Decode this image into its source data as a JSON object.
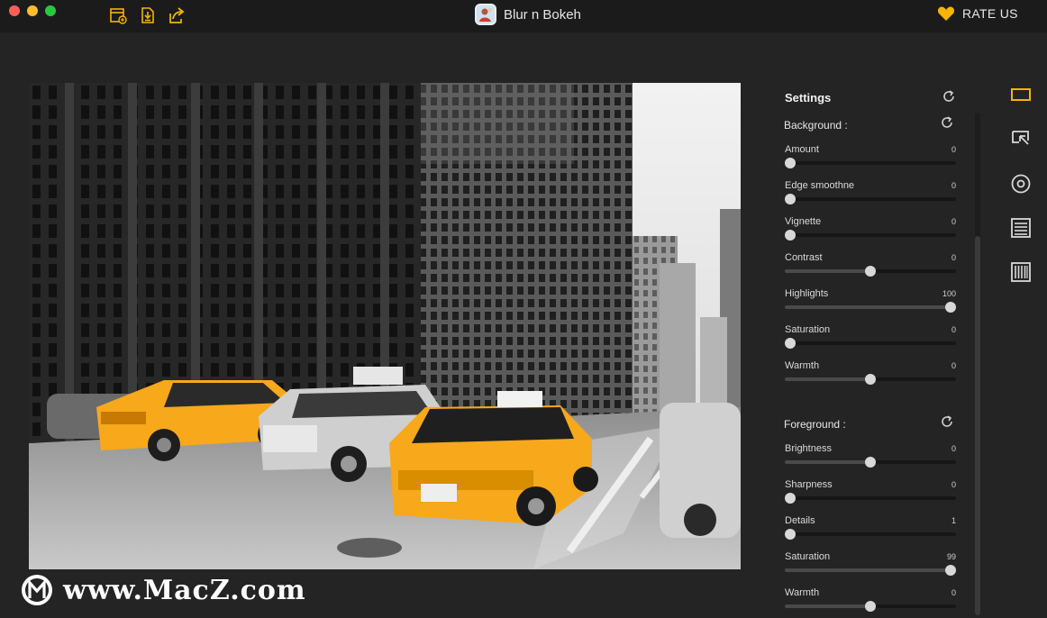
{
  "window": {
    "title": "Blur n Bokeh"
  },
  "header": {
    "rate_label": "RATE US"
  },
  "toolbar": {
    "icons": [
      "open-file-icon",
      "save-download-icon",
      "share-icon"
    ]
  },
  "settings": {
    "title": "Settings",
    "background": {
      "label": "Background :",
      "sliders": [
        {
          "label": "Amount",
          "value": "0",
          "level": 0
        },
        {
          "label": "Edge smoothne",
          "value": "0",
          "level": 0
        },
        {
          "label": "Vignette",
          "value": "0",
          "level": 0
        },
        {
          "label": "Contrast",
          "value": "0",
          "level": 0.5
        },
        {
          "label": "Highlights",
          "value": "100",
          "level": 1
        },
        {
          "label": "Saturation",
          "value": "0",
          "level": 0
        },
        {
          "label": "Warmth",
          "value": "0",
          "level": 0.5
        }
      ]
    },
    "foreground": {
      "label": "Foreground :",
      "sliders": [
        {
          "label": "Brightness",
          "value": "0",
          "level": 0.5
        },
        {
          "label": "Sharpness",
          "value": "0",
          "level": 0
        },
        {
          "label": "Details",
          "value": "1",
          "level": 0
        },
        {
          "label": "Saturation",
          "value": "99",
          "level": 0.99
        },
        {
          "label": "Warmth",
          "value": "0",
          "level": 0.5
        }
      ]
    }
  },
  "side_tools": [
    "crop-frame-icon",
    "selection-tool-icon",
    "focus-circle-icon",
    "lines-pattern-icon",
    "barcode-pattern-icon"
  ],
  "watermark": {
    "text": "www.MacZ.com"
  },
  "colors": {
    "accent": "#f5b400",
    "taxi_yellow": "#f7a81b",
    "background": "#242424"
  }
}
